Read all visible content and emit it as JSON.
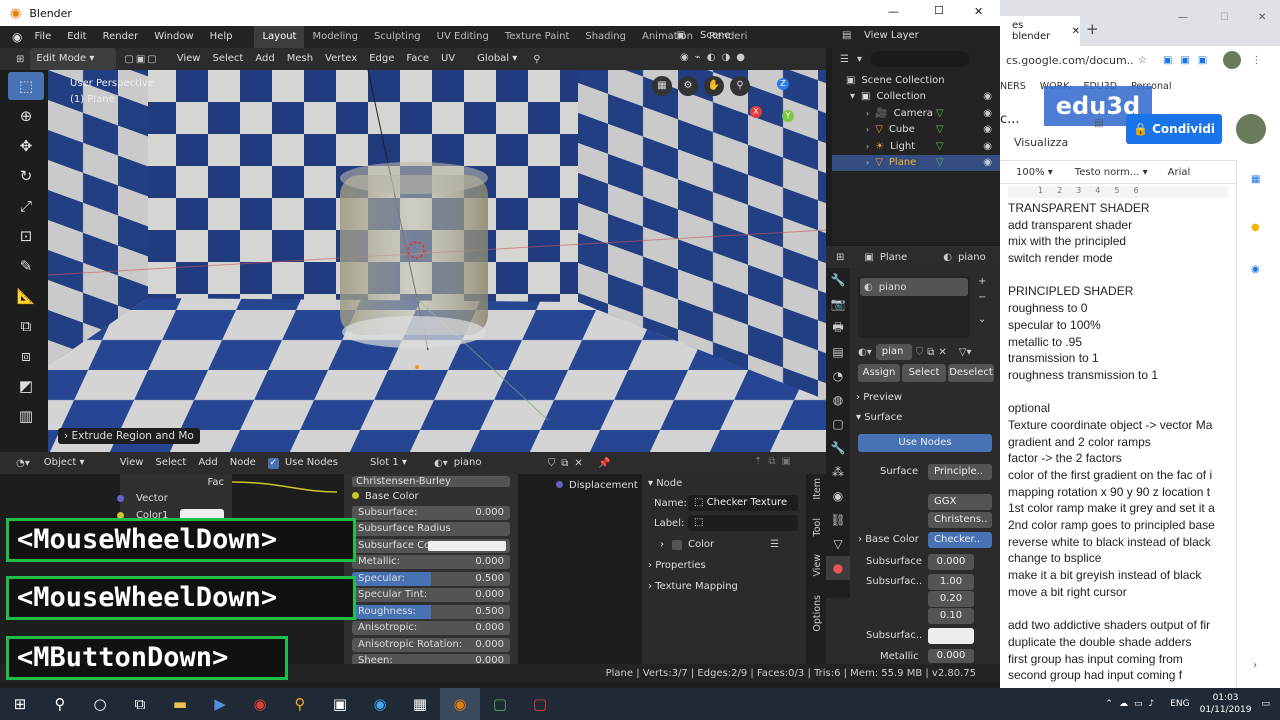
{
  "window": {
    "title": "Blender",
    "minimize": "—",
    "maximize": "☐",
    "close": "✕"
  },
  "menu": {
    "items": [
      "File",
      "Edit",
      "Render",
      "Window",
      "Help"
    ]
  },
  "workspaces": {
    "tabs": [
      "Layout",
      "Modeling",
      "Sculpting",
      "UV Editing",
      "Texture Paint",
      "Shading",
      "Animation",
      "Renderi"
    ],
    "active": "Layout"
  },
  "scene": {
    "label": "Scene",
    "view_layer": "View Layer"
  },
  "viewport_header": {
    "mode": "Edit Mode",
    "items": [
      "View",
      "Select",
      "Add",
      "Mesh",
      "Vertex",
      "Edge",
      "Face",
      "UV"
    ],
    "orientation": "Global"
  },
  "viewport": {
    "perspective": "User Perspective",
    "object": "(1) Plane",
    "operator": "Extrude Region and Mo",
    "gizmo": {
      "x": "X",
      "y": "Y",
      "z": "Z"
    }
  },
  "outliner": {
    "root": "Scene Collection",
    "collection": "Collection",
    "items": [
      {
        "name": "Camera",
        "icon": "camera-icon",
        "color": "#e69a3b"
      },
      {
        "name": "Cube",
        "icon": "cube-icon",
        "color": "#e69a3b"
      },
      {
        "name": "Light",
        "icon": "light-icon",
        "color": "#e69a3b"
      },
      {
        "name": "Plane",
        "icon": "plane-icon",
        "color": "#e69a3b",
        "selected": true
      }
    ]
  },
  "properties": {
    "object_name": "Plane",
    "material_name": "piano",
    "slot_item": "piano",
    "material_field": "pian",
    "assign": "Assign",
    "select": "Select",
    "deselect": "Deselect",
    "preview": "Preview",
    "surface": "Surface",
    "use_nodes": "Use Nodes",
    "surface_shader": "Principle..",
    "distribution": "GGX",
    "subsurface_method": "Christens..",
    "base_color_label": "Base Color",
    "base_color_value": "Checker..",
    "subsurface_label": "Subsurface",
    "subsurface_value": "0.000",
    "subsurface_radius_label": "Subsurfac..",
    "radius": [
      "1.00",
      "0.20",
      "0.10"
    ],
    "subsurface_color_label": "Subsurfac..",
    "metallic_label": "Metallic",
    "metallic_value": "0.000",
    "surface_label": "Surface"
  },
  "node_header": {
    "type": "Object",
    "items": [
      "View",
      "Select",
      "Add",
      "Node"
    ],
    "use_nodes": "Use Nodes",
    "slot": "Slot 1",
    "material": "piano"
  },
  "node_editor": {
    "checker": {
      "fac": "Fac",
      "vector": "Vector",
      "color1": "Color1"
    },
    "principled": {
      "distribution": "Christensen-Burley",
      "base_color": "Base Color",
      "rows": [
        {
          "label": "Subsurface:",
          "value": "0.000",
          "fill": 0
        },
        {
          "label": "Subsurface Radius",
          "value": "",
          "fill": 0
        },
        {
          "label": "Subsurface Color",
          "value": "",
          "fill": 0
        },
        {
          "label": "Metallic:",
          "value": "0.000",
          "fill": 0
        },
        {
          "label": "Specular:",
          "value": "0.500",
          "fill": 0.5
        },
        {
          "label": "Specular Tint:",
          "value": "0.000",
          "fill": 0
        },
        {
          "label": "Roughness:",
          "value": "0.500",
          "fill": 0.5
        },
        {
          "label": "Anisotropic:",
          "value": "0.000",
          "fill": 0
        },
        {
          "label": "Anisotropic Rotation:",
          "value": "0.000",
          "fill": 0
        },
        {
          "label": "Sheen:",
          "value": "0.000",
          "fill": 0
        }
      ]
    },
    "displacement": "Displacement"
  },
  "node_panel": {
    "title": "Node",
    "name_label": "Name:",
    "name_value": "Checker Texture",
    "label_label": "Label:",
    "color": "Color",
    "properties": "Properties",
    "texture_mapping": "Texture Mapping"
  },
  "side_tabs": [
    "Item",
    "Tool",
    "View",
    "Options"
  ],
  "status": "Plane | Verts:3/7 | Edges:2/9 | Faces:0/3 | Tris:6 | Mem: 55.9 MB | v2.80.75",
  "key_overlays": [
    "<MouseWheelDown>",
    "<MouseWheelDown>",
    "<MButtonDown>"
  ],
  "browser": {
    "tab_title": "es blender",
    "url": "cs.google.com/docum...",
    "bookmarks": [
      "NERS",
      "WORK",
      "EDU3D",
      "Personal"
    ],
    "doc_title_fragment": "c...",
    "menu_fragment": "Visualizza",
    "share": "Condividi",
    "logo": "edu3d",
    "zoom": "100%",
    "style": "Testo norm...",
    "font": "Arial"
  },
  "document_lines": [
    "TRANSPARENT SHADER",
    "add transparent shader",
    "mix with the principled",
    "switch render mode",
    "",
    "PRINCIPLED SHADER",
    "roughness to 0",
    "specular to 100%",
    "metallic to .95",
    "transmission to 1",
    "roughness transmission to 1",
    "",
    "optional",
    "Texture coordinate object -> vector Ma",
    "gradient and 2 color ramps",
    "factor -> the 2 factors",
    "color of the first gradient on the fac of i",
    "mapping rotation x 90 y 90 z location t",
    "1st color ramp make it grey and set it a",
    "2nd color ramp goes to principled base",
    "reverse white to black instead of black",
    "change to bsplice",
    "make it a bit greyish instead of black",
    "move a bit right cursor",
    "",
    "add two addictive shaders output of fir",
    "duplicate the double shade adders",
    "first group has input coming from",
    "second group had input coming f"
  ],
  "taskbar": {
    "lang": "ENG",
    "time": "01:03",
    "date": "01/11/2019"
  }
}
